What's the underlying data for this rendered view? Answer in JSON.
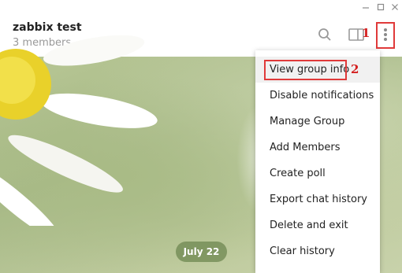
{
  "header": {
    "title": "zabbix test",
    "subtitle": "3 members",
    "icons": [
      "search-icon",
      "sidebar-toggle-icon",
      "more-vertical-icon"
    ]
  },
  "window_controls": [
    "minimize-icon",
    "maximize-icon",
    "close-icon"
  ],
  "menu": {
    "items": [
      {
        "label": "View group info"
      },
      {
        "label": "Disable notifications"
      },
      {
        "label": "Manage Group"
      },
      {
        "label": "Add Members"
      },
      {
        "label": "Create poll"
      },
      {
        "label": "Export chat history"
      },
      {
        "label": "Delete and exit"
      },
      {
        "label": "Clear history"
      }
    ]
  },
  "chat": {
    "date_pill": "July 22"
  },
  "annotations": {
    "step1": "1",
    "step2": "2",
    "color": "#e03a3a"
  }
}
